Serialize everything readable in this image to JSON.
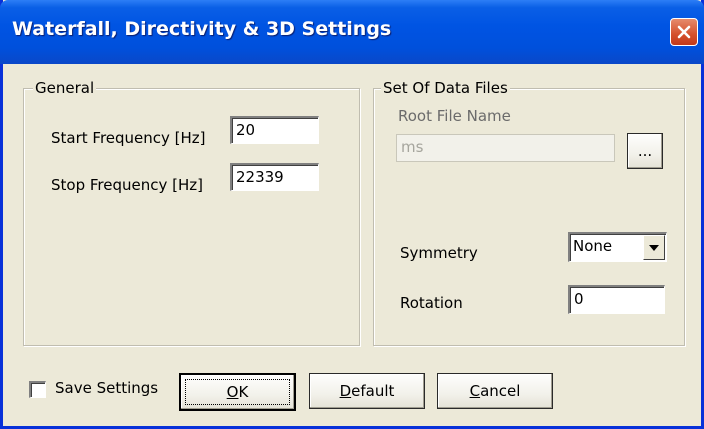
{
  "window": {
    "title": "Waterfall, Directivity & 3D Settings"
  },
  "general": {
    "legend": "General",
    "start_frequency_label": "Start Frequency [Hz]",
    "start_frequency_value": "20",
    "stop_frequency_label": "Stop Frequency [Hz]",
    "stop_frequency_value": "22339"
  },
  "data_files": {
    "legend": "Set Of Data Files",
    "root_file_name_label": "Root File Name",
    "root_file_name_value": "ms",
    "browse_label": "...",
    "symmetry_label": "Symmetry",
    "symmetry_value": "None",
    "rotation_label": "Rotation",
    "rotation_value": "0"
  },
  "footer": {
    "save_settings_label": "Save Settings",
    "save_settings_checked": false,
    "ok_mnemonic": "O",
    "ok_rest": "K",
    "default_mnemonic": "D",
    "default_rest": "efault",
    "cancel_mnemonic": "C",
    "cancel_rest": "ancel"
  },
  "colors": {
    "titlebar": "#0054e3",
    "close_button": "#d4502c",
    "dialog_background": "#ece9d8"
  },
  "icons": {
    "close": "close-icon",
    "dropdown": "chevron-down-icon"
  }
}
